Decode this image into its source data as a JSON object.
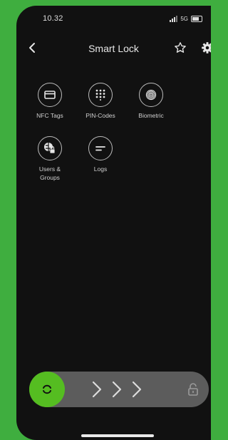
{
  "status_bar": {
    "time": "10.32",
    "network": "5G"
  },
  "header": {
    "title": "Smart Lock"
  },
  "features": [
    {
      "label": "NFC Tags",
      "icon": "card-icon"
    },
    {
      "label": "PIN-Codes",
      "icon": "keypad-icon"
    },
    {
      "label": "Biometric",
      "icon": "fingerprint-icon"
    },
    {
      "label": "Users & Groups",
      "icon": "users-lock-icon"
    },
    {
      "label": "Logs",
      "icon": "logs-icon"
    }
  ],
  "swipe": {
    "chevrons": "> > >"
  },
  "colors": {
    "accent": "#55bd21",
    "background": "#111111",
    "frame": "#3fae3f"
  }
}
